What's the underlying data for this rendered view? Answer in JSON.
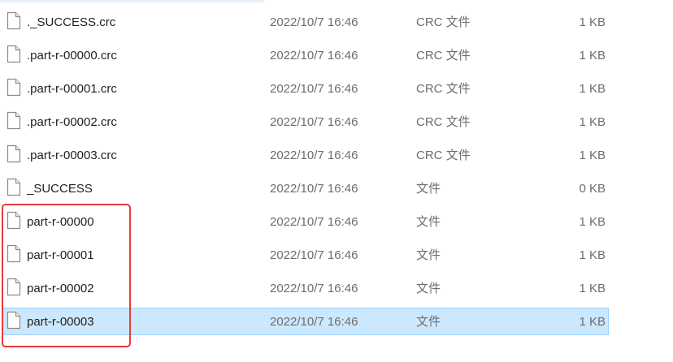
{
  "file_list": {
    "rows": [
      {
        "name": "._SUCCESS.crc",
        "date": "2022/10/7 16:46",
        "type": "CRC 文件",
        "size": "1 KB",
        "selected": false
      },
      {
        "name": ".part-r-00000.crc",
        "date": "2022/10/7 16:46",
        "type": "CRC 文件",
        "size": "1 KB",
        "selected": false
      },
      {
        "name": ".part-r-00001.crc",
        "date": "2022/10/7 16:46",
        "type": "CRC 文件",
        "size": "1 KB",
        "selected": false
      },
      {
        "name": ".part-r-00002.crc",
        "date": "2022/10/7 16:46",
        "type": "CRC 文件",
        "size": "1 KB",
        "selected": false
      },
      {
        "name": ".part-r-00003.crc",
        "date": "2022/10/7 16:46",
        "type": "CRC 文件",
        "size": "1 KB",
        "selected": false
      },
      {
        "name": "_SUCCESS",
        "date": "2022/10/7 16:46",
        "type": "文件",
        "size": "0 KB",
        "selected": false
      },
      {
        "name": "part-r-00000",
        "date": "2022/10/7 16:46",
        "type": "文件",
        "size": "1 KB",
        "selected": false
      },
      {
        "name": "part-r-00001",
        "date": "2022/10/7 16:46",
        "type": "文件",
        "size": "1 KB",
        "selected": false
      },
      {
        "name": "part-r-00002",
        "date": "2022/10/7 16:46",
        "type": "文件",
        "size": "1 KB",
        "selected": false
      },
      {
        "name": "part-r-00003",
        "date": "2022/10/7 16:46",
        "type": "文件",
        "size": "1 KB",
        "selected": true
      }
    ],
    "icon": "file-icon"
  },
  "colors": {
    "selection_fill": "#cce8ff",
    "selection_border": "#99d1ff",
    "annotation_box": "#e63b3b",
    "secondary_text": "#6d6d6d"
  }
}
